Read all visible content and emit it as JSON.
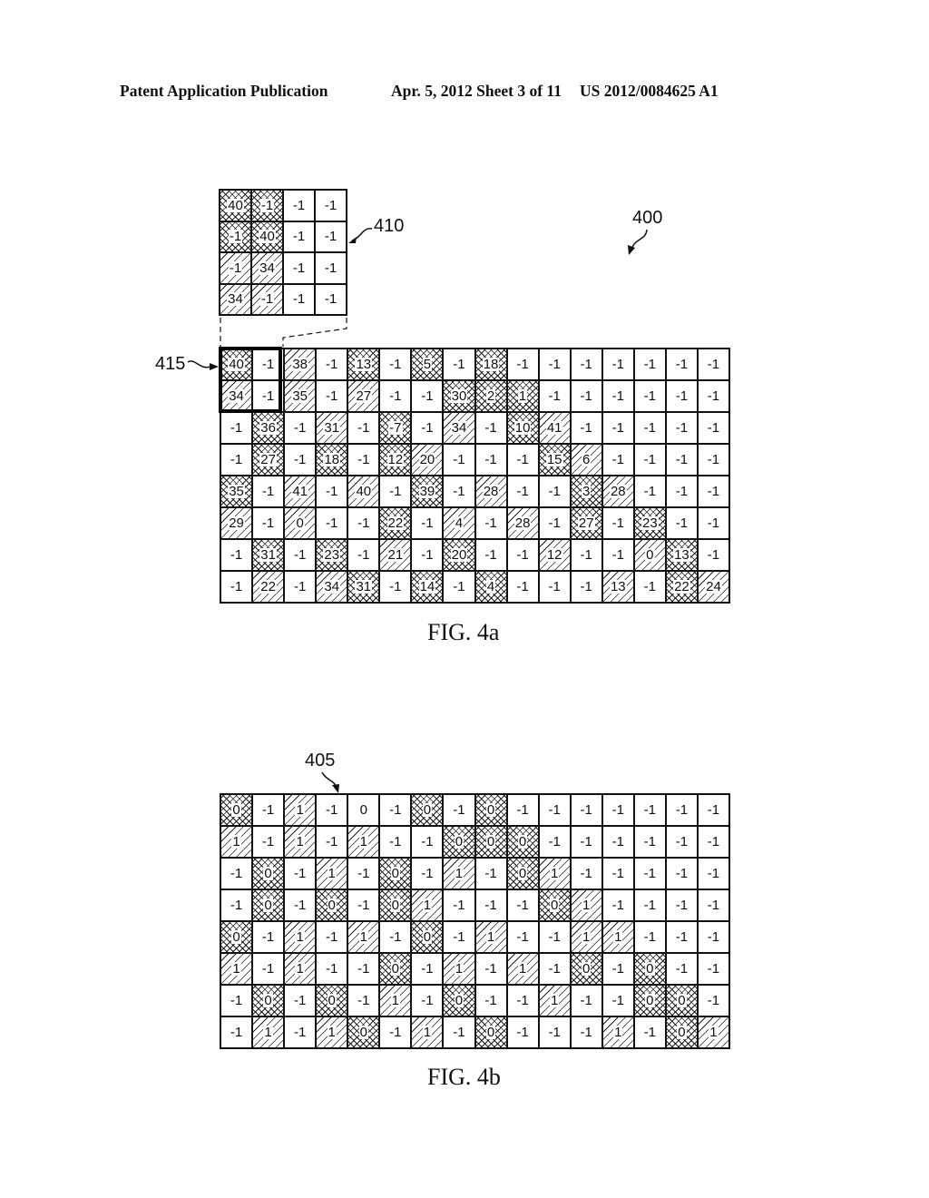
{
  "header": {
    "title": "Patent Application Publication",
    "date_sheet": "Apr. 5, 2012   Sheet 3 of 11",
    "number": "US 2012/0084625 A1"
  },
  "legend": {
    "x": "cross-hatch",
    "d": "diagonal-hatch",
    "n": "no shading"
  },
  "figures": {
    "fig4a": {
      "caption": "FIG. 4a",
      "ref_matrix": "400",
      "ref_submatrix": "410",
      "ref_block": "415",
      "submatrix_410": [
        [
          [
            "40",
            "x"
          ],
          [
            "-1",
            "x"
          ],
          [
            "-1",
            "n"
          ],
          [
            "-1",
            "n"
          ]
        ],
        [
          [
            "-1",
            "x"
          ],
          [
            "40",
            "x"
          ],
          [
            "-1",
            "n"
          ],
          [
            "-1",
            "n"
          ]
        ],
        [
          [
            "-1",
            "d"
          ],
          [
            "34",
            "d"
          ],
          [
            "-1",
            "n"
          ],
          [
            "-1",
            "n"
          ]
        ],
        [
          [
            "34",
            "d"
          ],
          [
            "-1",
            "d"
          ],
          [
            "-1",
            "n"
          ],
          [
            "-1",
            "n"
          ]
        ]
      ],
      "matrix": [
        [
          [
            "40",
            "x"
          ],
          [
            "-1",
            "n"
          ],
          [
            "38",
            "d"
          ],
          [
            "-1",
            "n"
          ],
          [
            "13",
            "x"
          ],
          [
            "-1",
            "n"
          ],
          [
            "5",
            "x"
          ],
          [
            "-1",
            "n"
          ],
          [
            "18",
            "x"
          ],
          [
            "-1",
            "n"
          ],
          [
            "-1",
            "n"
          ],
          [
            "-1",
            "n"
          ],
          [
            "-1",
            "n"
          ],
          [
            "-1",
            "n"
          ],
          [
            "-1",
            "n"
          ],
          [
            "-1",
            "n"
          ]
        ],
        [
          [
            "34",
            "d"
          ],
          [
            "-1",
            "n"
          ],
          [
            "35",
            "d"
          ],
          [
            "-1",
            "n"
          ],
          [
            "27",
            "d"
          ],
          [
            "-1",
            "n"
          ],
          [
            "-1",
            "n"
          ],
          [
            "30",
            "x"
          ],
          [
            "2",
            "x"
          ],
          [
            "1",
            "x"
          ],
          [
            "-1",
            "n"
          ],
          [
            "-1",
            "n"
          ],
          [
            "-1",
            "n"
          ],
          [
            "-1",
            "n"
          ],
          [
            "-1",
            "n"
          ],
          [
            "-1",
            "n"
          ]
        ],
        [
          [
            "-1",
            "n"
          ],
          [
            "36",
            "x"
          ],
          [
            "-1",
            "n"
          ],
          [
            "31",
            "d"
          ],
          [
            "-1",
            "n"
          ],
          [
            "-7",
            "x"
          ],
          [
            "-1",
            "n"
          ],
          [
            "34",
            "d"
          ],
          [
            "-1",
            "n"
          ],
          [
            "10",
            "x"
          ],
          [
            "41",
            "d"
          ],
          [
            "-1",
            "n"
          ],
          [
            "-1",
            "n"
          ],
          [
            "-1",
            "n"
          ],
          [
            "-1",
            "n"
          ],
          [
            "-1",
            "n"
          ]
        ],
        [
          [
            "-1",
            "n"
          ],
          [
            "27",
            "x"
          ],
          [
            "-1",
            "n"
          ],
          [
            "18",
            "x"
          ],
          [
            "-1",
            "n"
          ],
          [
            "12",
            "x"
          ],
          [
            "20",
            "d"
          ],
          [
            "-1",
            "n"
          ],
          [
            "-1",
            "n"
          ],
          [
            "-1",
            "n"
          ],
          [
            "15",
            "x"
          ],
          [
            "6",
            "d"
          ],
          [
            "-1",
            "n"
          ],
          [
            "-1",
            "n"
          ],
          [
            "-1",
            "n"
          ],
          [
            "-1",
            "n"
          ]
        ],
        [
          [
            "35",
            "x"
          ],
          [
            "-1",
            "n"
          ],
          [
            "41",
            "d"
          ],
          [
            "-1",
            "n"
          ],
          [
            "40",
            "d"
          ],
          [
            "-1",
            "n"
          ],
          [
            "39",
            "x"
          ],
          [
            "-1",
            "n"
          ],
          [
            "28",
            "d"
          ],
          [
            "-1",
            "n"
          ],
          [
            "-1",
            "n"
          ],
          [
            "3",
            "x"
          ],
          [
            "28",
            "d"
          ],
          [
            "-1",
            "n"
          ],
          [
            "-1",
            "n"
          ],
          [
            "-1",
            "n"
          ]
        ],
        [
          [
            "29",
            "d"
          ],
          [
            "-1",
            "n"
          ],
          [
            "0",
            "d"
          ],
          [
            "-1",
            "n"
          ],
          [
            "-1",
            "n"
          ],
          [
            "22",
            "x"
          ],
          [
            "-1",
            "n"
          ],
          [
            "4",
            "d"
          ],
          [
            "-1",
            "n"
          ],
          [
            "28",
            "d"
          ],
          [
            "-1",
            "n"
          ],
          [
            "27",
            "x"
          ],
          [
            "-1",
            "n"
          ],
          [
            "23",
            "x"
          ],
          [
            "-1",
            "n"
          ],
          [
            "-1",
            "n"
          ]
        ],
        [
          [
            "-1",
            "n"
          ],
          [
            "31",
            "x"
          ],
          [
            "-1",
            "n"
          ],
          [
            "23",
            "x"
          ],
          [
            "-1",
            "n"
          ],
          [
            "21",
            "d"
          ],
          [
            "-1",
            "n"
          ],
          [
            "20",
            "x"
          ],
          [
            "-1",
            "n"
          ],
          [
            "-1",
            "n"
          ],
          [
            "12",
            "d"
          ],
          [
            "-1",
            "n"
          ],
          [
            "-1",
            "n"
          ],
          [
            "0",
            "d"
          ],
          [
            "13",
            "x"
          ],
          [
            "-1",
            "n"
          ]
        ],
        [
          [
            "-1",
            "n"
          ],
          [
            "22",
            "d"
          ],
          [
            "-1",
            "n"
          ],
          [
            "34",
            "d"
          ],
          [
            "31",
            "x"
          ],
          [
            "-1",
            "n"
          ],
          [
            "14",
            "x"
          ],
          [
            "-1",
            "n"
          ],
          [
            "4",
            "x"
          ],
          [
            "-1",
            "n"
          ],
          [
            "-1",
            "n"
          ],
          [
            "-1",
            "n"
          ],
          [
            "13",
            "d"
          ],
          [
            "-1",
            "n"
          ],
          [
            "22",
            "x"
          ],
          [
            "24",
            "d"
          ]
        ]
      ]
    },
    "fig4b": {
      "caption": "FIG. 4b",
      "ref_matrix": "405",
      "matrix": [
        [
          [
            "0",
            "x"
          ],
          [
            "-1",
            "n"
          ],
          [
            "1",
            "d"
          ],
          [
            "-1",
            "n"
          ],
          [
            "0",
            "n"
          ],
          [
            "-1",
            "n"
          ],
          [
            "0",
            "x"
          ],
          [
            "-1",
            "n"
          ],
          [
            "0",
            "x"
          ],
          [
            "-1",
            "n"
          ],
          [
            "-1",
            "n"
          ],
          [
            "-1",
            "n"
          ],
          [
            "-1",
            "n"
          ],
          [
            "-1",
            "n"
          ],
          [
            "-1",
            "n"
          ],
          [
            "-1",
            "n"
          ]
        ],
        [
          [
            "1",
            "d"
          ],
          [
            "-1",
            "n"
          ],
          [
            "1",
            "d"
          ],
          [
            "-1",
            "n"
          ],
          [
            "1",
            "d"
          ],
          [
            "-1",
            "n"
          ],
          [
            "-1",
            "n"
          ],
          [
            "0",
            "x"
          ],
          [
            "0",
            "x"
          ],
          [
            "0",
            "x"
          ],
          [
            "-1",
            "n"
          ],
          [
            "-1",
            "n"
          ],
          [
            "-1",
            "n"
          ],
          [
            "-1",
            "n"
          ],
          [
            "-1",
            "n"
          ],
          [
            "-1",
            "n"
          ]
        ],
        [
          [
            "-1",
            "n"
          ],
          [
            "0",
            "x"
          ],
          [
            "-1",
            "n"
          ],
          [
            "1",
            "d"
          ],
          [
            "-1",
            "n"
          ],
          [
            "0",
            "x"
          ],
          [
            "-1",
            "n"
          ],
          [
            "1",
            "d"
          ],
          [
            "-1",
            "n"
          ],
          [
            "0",
            "x"
          ],
          [
            "1",
            "d"
          ],
          [
            "-1",
            "n"
          ],
          [
            "-1",
            "n"
          ],
          [
            "-1",
            "n"
          ],
          [
            "-1",
            "n"
          ],
          [
            "-1",
            "n"
          ]
        ],
        [
          [
            "-1",
            "n"
          ],
          [
            "0",
            "x"
          ],
          [
            "-1",
            "n"
          ],
          [
            "0",
            "x"
          ],
          [
            "-1",
            "n"
          ],
          [
            "0",
            "x"
          ],
          [
            "1",
            "d"
          ],
          [
            "-1",
            "n"
          ],
          [
            "-1",
            "n"
          ],
          [
            "-1",
            "n"
          ],
          [
            "0",
            "x"
          ],
          [
            "1",
            "d"
          ],
          [
            "-1",
            "n"
          ],
          [
            "-1",
            "n"
          ],
          [
            "-1",
            "n"
          ],
          [
            "-1",
            "n"
          ]
        ],
        [
          [
            "0",
            "x"
          ],
          [
            "-1",
            "n"
          ],
          [
            "1",
            "d"
          ],
          [
            "-1",
            "n"
          ],
          [
            "1",
            "d"
          ],
          [
            "-1",
            "n"
          ],
          [
            "0",
            "x"
          ],
          [
            "-1",
            "n"
          ],
          [
            "1",
            "d"
          ],
          [
            "-1",
            "n"
          ],
          [
            "-1",
            "n"
          ],
          [
            "1",
            "d"
          ],
          [
            "1",
            "d"
          ],
          [
            "-1",
            "n"
          ],
          [
            "-1",
            "n"
          ],
          [
            "-1",
            "n"
          ]
        ],
        [
          [
            "1",
            "d"
          ],
          [
            "-1",
            "n"
          ],
          [
            "1",
            "d"
          ],
          [
            "-1",
            "n"
          ],
          [
            "-1",
            "n"
          ],
          [
            "0",
            "x"
          ],
          [
            "-1",
            "n"
          ],
          [
            "1",
            "d"
          ],
          [
            "-1",
            "n"
          ],
          [
            "1",
            "d"
          ],
          [
            "-1",
            "n"
          ],
          [
            "0",
            "x"
          ],
          [
            "-1",
            "n"
          ],
          [
            "0",
            "x"
          ],
          [
            "-1",
            "n"
          ],
          [
            "-1",
            "n"
          ]
        ],
        [
          [
            "-1",
            "n"
          ],
          [
            "0",
            "x"
          ],
          [
            "-1",
            "n"
          ],
          [
            "0",
            "x"
          ],
          [
            "-1",
            "n"
          ],
          [
            "1",
            "d"
          ],
          [
            "-1",
            "n"
          ],
          [
            "0",
            "x"
          ],
          [
            "-1",
            "n"
          ],
          [
            "-1",
            "n"
          ],
          [
            "1",
            "d"
          ],
          [
            "-1",
            "n"
          ],
          [
            "-1",
            "n"
          ],
          [
            "0",
            "x"
          ],
          [
            "0",
            "x"
          ],
          [
            "-1",
            "n"
          ]
        ],
        [
          [
            "-1",
            "n"
          ],
          [
            "1",
            "d"
          ],
          [
            "-1",
            "n"
          ],
          [
            "1",
            "d"
          ],
          [
            "0",
            "x"
          ],
          [
            "-1",
            "n"
          ],
          [
            "1",
            "d"
          ],
          [
            "-1",
            "n"
          ],
          [
            "0",
            "x"
          ],
          [
            "-1",
            "n"
          ],
          [
            "-1",
            "n"
          ],
          [
            "-1",
            "n"
          ],
          [
            "1",
            "d"
          ],
          [
            "-1",
            "n"
          ],
          [
            "0",
            "x"
          ],
          [
            "1",
            "d"
          ]
        ]
      ]
    }
  }
}
